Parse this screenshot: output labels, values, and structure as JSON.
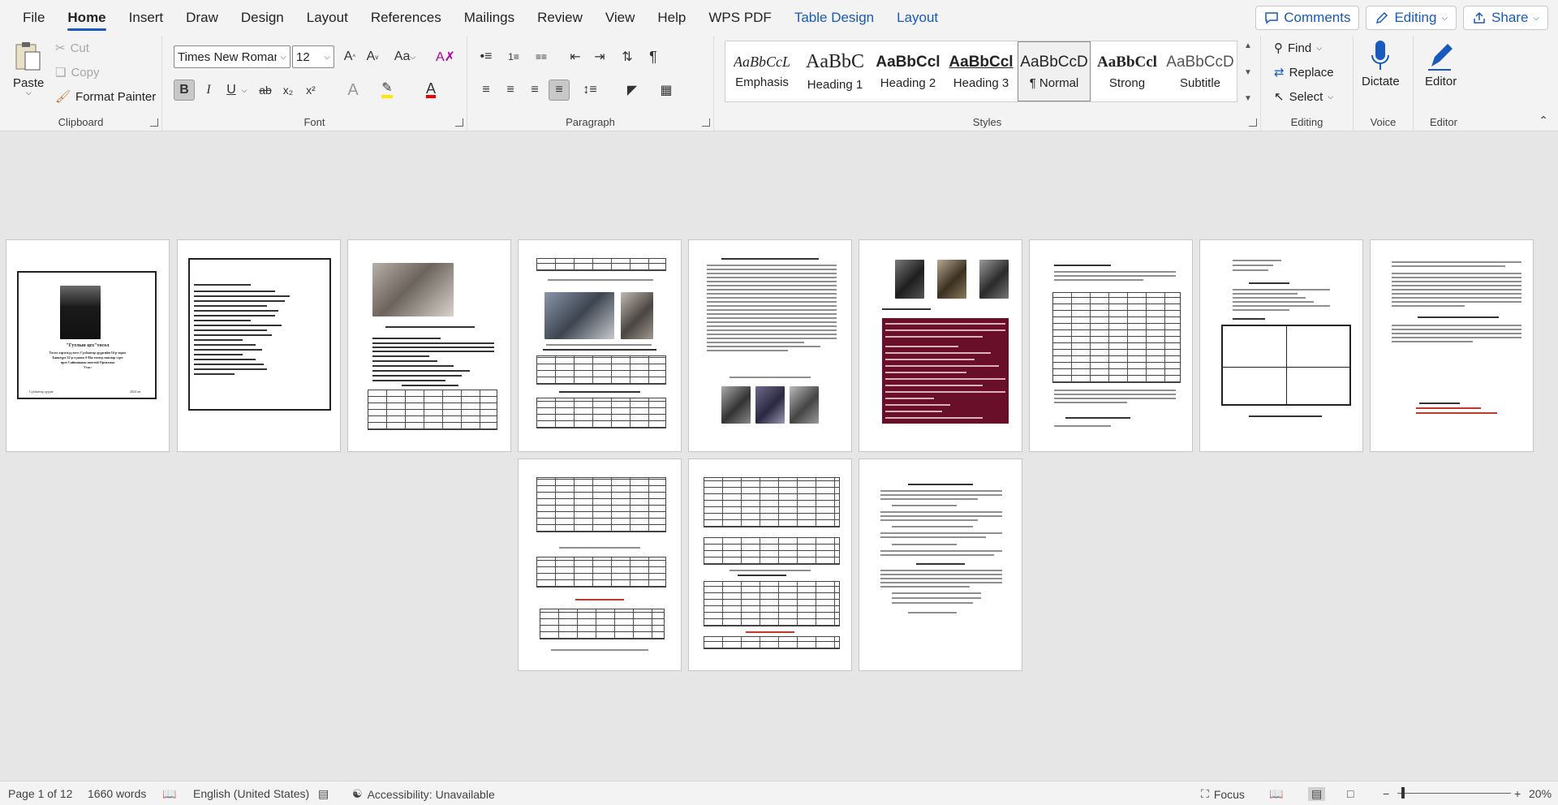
{
  "menu": {
    "tabs": [
      {
        "label": "File"
      },
      {
        "label": "Home"
      },
      {
        "label": "Insert"
      },
      {
        "label": "Draw"
      },
      {
        "label": "Design"
      },
      {
        "label": "Layout"
      },
      {
        "label": "References"
      },
      {
        "label": "Mailings"
      },
      {
        "label": "Review"
      },
      {
        "label": "View"
      },
      {
        "label": "Help"
      },
      {
        "label": "WPS PDF"
      },
      {
        "label": "Table Design"
      },
      {
        "label": "Layout"
      }
    ],
    "comments": "Comments",
    "editing": "Editing",
    "share": "Share"
  },
  "clipboard": {
    "paste": "Paste",
    "cut": "Cut",
    "copy": "Copy",
    "format_painter": "Format Painter",
    "label": "Clipboard"
  },
  "font": {
    "family": "Times New Roman",
    "size": "12",
    "label": "Font",
    "bold": "B",
    "italic": "I",
    "underline": "U",
    "strike": "ab",
    "sub": "x₂",
    "sup": "x²"
  },
  "paragraph": {
    "label": "Paragraph"
  },
  "styles": {
    "label": "Styles",
    "items": [
      {
        "preview": "AaBbCcL",
        "name": "Emphasis"
      },
      {
        "preview": "AaBbC",
        "name": "Heading 1"
      },
      {
        "preview": "AaBbCcl",
        "name": "Heading 2"
      },
      {
        "preview": "AaBbCcl",
        "name": "Heading 3"
      },
      {
        "preview": "AaBbCcD",
        "name": "¶ Normal"
      },
      {
        "preview": "AaBbCcl",
        "name": "Strong"
      },
      {
        "preview": "AaBbCcD",
        "name": "Subtitle"
      }
    ]
  },
  "editing": {
    "find": "Find",
    "replace": "Replace",
    "select": "Select",
    "label": "Editing"
  },
  "voice": {
    "dictate": "Dictate",
    "label": "Voice"
  },
  "editor": {
    "editor": "Editor",
    "label": "Editor"
  },
  "document": {
    "cover_title": "\"Гутлын цех\"төсөл",
    "cover_lines": [
      "Төсөл хэрэгжүүлэгч: Сүхбаатар дүүргийн 16-р хороо",
      "Баянзүрх 22-р гудамж б-84а тоотод хаягаар сурч",
      "ирээ Сайнзаяаын овогтой Оргилмаа",
      "Утас:"
    ],
    "cover_footer_left": "Сүхбаатар дүүрэг",
    "cover_footer_right": "2024 он"
  },
  "status": {
    "page": "Page 1 of 12",
    "words": "1660 words",
    "language": "English (United States)",
    "accessibility": "Accessibility: Unavailable",
    "focus": "Focus",
    "zoom": "20%"
  },
  "colors": {
    "accent": "#185abd",
    "ribbon_bg": "#f3f3f3",
    "canvas_bg": "#e6e6e6",
    "dark_red_page": "#6a0f2a"
  }
}
